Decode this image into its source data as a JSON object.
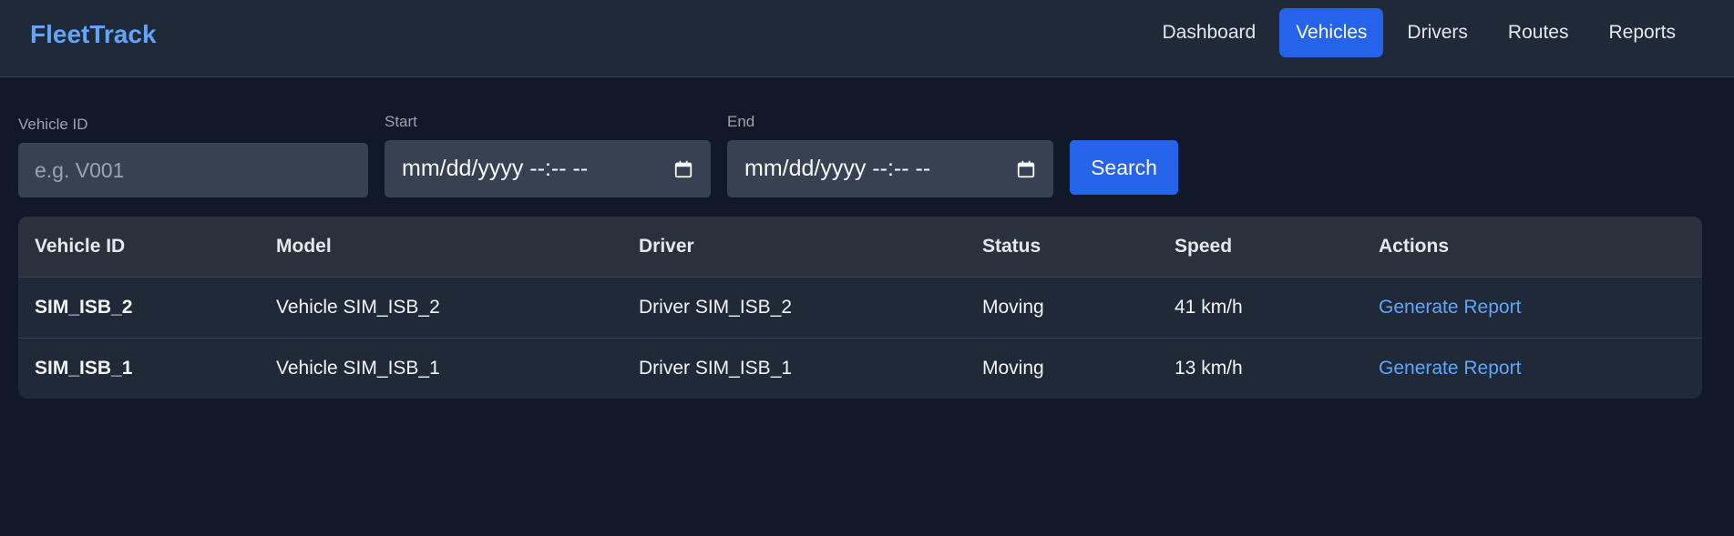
{
  "header": {
    "brand": "FleetTrack",
    "nav": [
      {
        "label": "Dashboard",
        "active": false
      },
      {
        "label": "Vehicles",
        "active": true
      },
      {
        "label": "Drivers",
        "active": false
      },
      {
        "label": "Routes",
        "active": false
      },
      {
        "label": "Reports",
        "active": false
      }
    ]
  },
  "filters": {
    "vehicle_id": {
      "label": "Vehicle ID",
      "placeholder": "e.g. V001",
      "value": ""
    },
    "start": {
      "label": "Start",
      "value": "mm/dd/yyyy --:-- --",
      "icon": "calendar-icon"
    },
    "end": {
      "label": "End",
      "value": "mm/dd/yyyy --:-- --",
      "icon": "calendar-icon"
    },
    "search_label": "Search"
  },
  "table": {
    "columns": [
      "Vehicle ID",
      "Model",
      "Driver",
      "Status",
      "Speed",
      "Actions"
    ],
    "rows": [
      {
        "vehicle_id": "SIM_ISB_2",
        "model": "Vehicle SIM_ISB_2",
        "driver": "Driver SIM_ISB_2",
        "status": "Moving",
        "speed": "41 km/h",
        "action": "Generate Report"
      },
      {
        "vehicle_id": "SIM_ISB_1",
        "model": "Vehicle SIM_ISB_1",
        "driver": "Driver SIM_ISB_1",
        "status": "Moving",
        "speed": "13 km/h",
        "action": "Generate Report"
      }
    ]
  },
  "colors": {
    "background": "#111827",
    "header": "#1f2937",
    "accent": "#2563eb",
    "link": "#60a5fa"
  }
}
